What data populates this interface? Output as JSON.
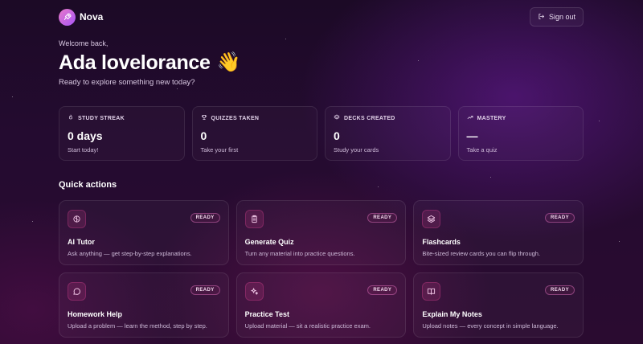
{
  "header": {
    "brand": "Nova",
    "sign_out_label": "Sign out"
  },
  "hero": {
    "welcome": "Welcome back,",
    "name": "Ada lovelorance",
    "wave_emoji": "👋",
    "subtitle": "Ready to explore something new today?"
  },
  "stats": [
    {
      "label": "STUDY STREAK",
      "value": "0 days",
      "sub": "Start today!",
      "icon": "flame-icon"
    },
    {
      "label": "QUIZZES TAKEN",
      "value": "0",
      "sub": "Take your first",
      "icon": "trophy-icon"
    },
    {
      "label": "DECKS CREATED",
      "value": "0",
      "sub": "Study your cards",
      "icon": "layers-icon"
    },
    {
      "label": "MASTERY",
      "value": "—",
      "sub": "Take a quiz",
      "icon": "trend-up-icon"
    }
  ],
  "quick_actions": {
    "title": "Quick actions",
    "items": [
      {
        "title": "AI Tutor",
        "desc": "Ask anything — get step-by-step explanations.",
        "badge": "READY",
        "icon": "brain-icon"
      },
      {
        "title": "Generate Quiz",
        "desc": "Turn any material into practice questions.",
        "badge": "READY",
        "icon": "clipboard-icon"
      },
      {
        "title": "Flashcards",
        "desc": "Bite-sized review cards you can flip through.",
        "badge": "READY",
        "icon": "layers-icon"
      },
      {
        "title": "Homework Help",
        "desc": "Upload a problem — learn the method, step by step.",
        "badge": "READY",
        "icon": "chat-bubble-icon"
      },
      {
        "title": "Practice Test",
        "desc": "Upload material — sit a realistic practice exam.",
        "badge": "READY",
        "icon": "sparkles-icon"
      },
      {
        "title": "Explain My Notes",
        "desc": "Upload notes — every concept in simple language.",
        "badge": "READY",
        "icon": "book-open-icon"
      }
    ]
  },
  "colors": {
    "accent": "#ec4899",
    "brand_gradient_start": "#e879c9",
    "brand_gradient_end": "#a855f7",
    "background": "#220b2d"
  }
}
